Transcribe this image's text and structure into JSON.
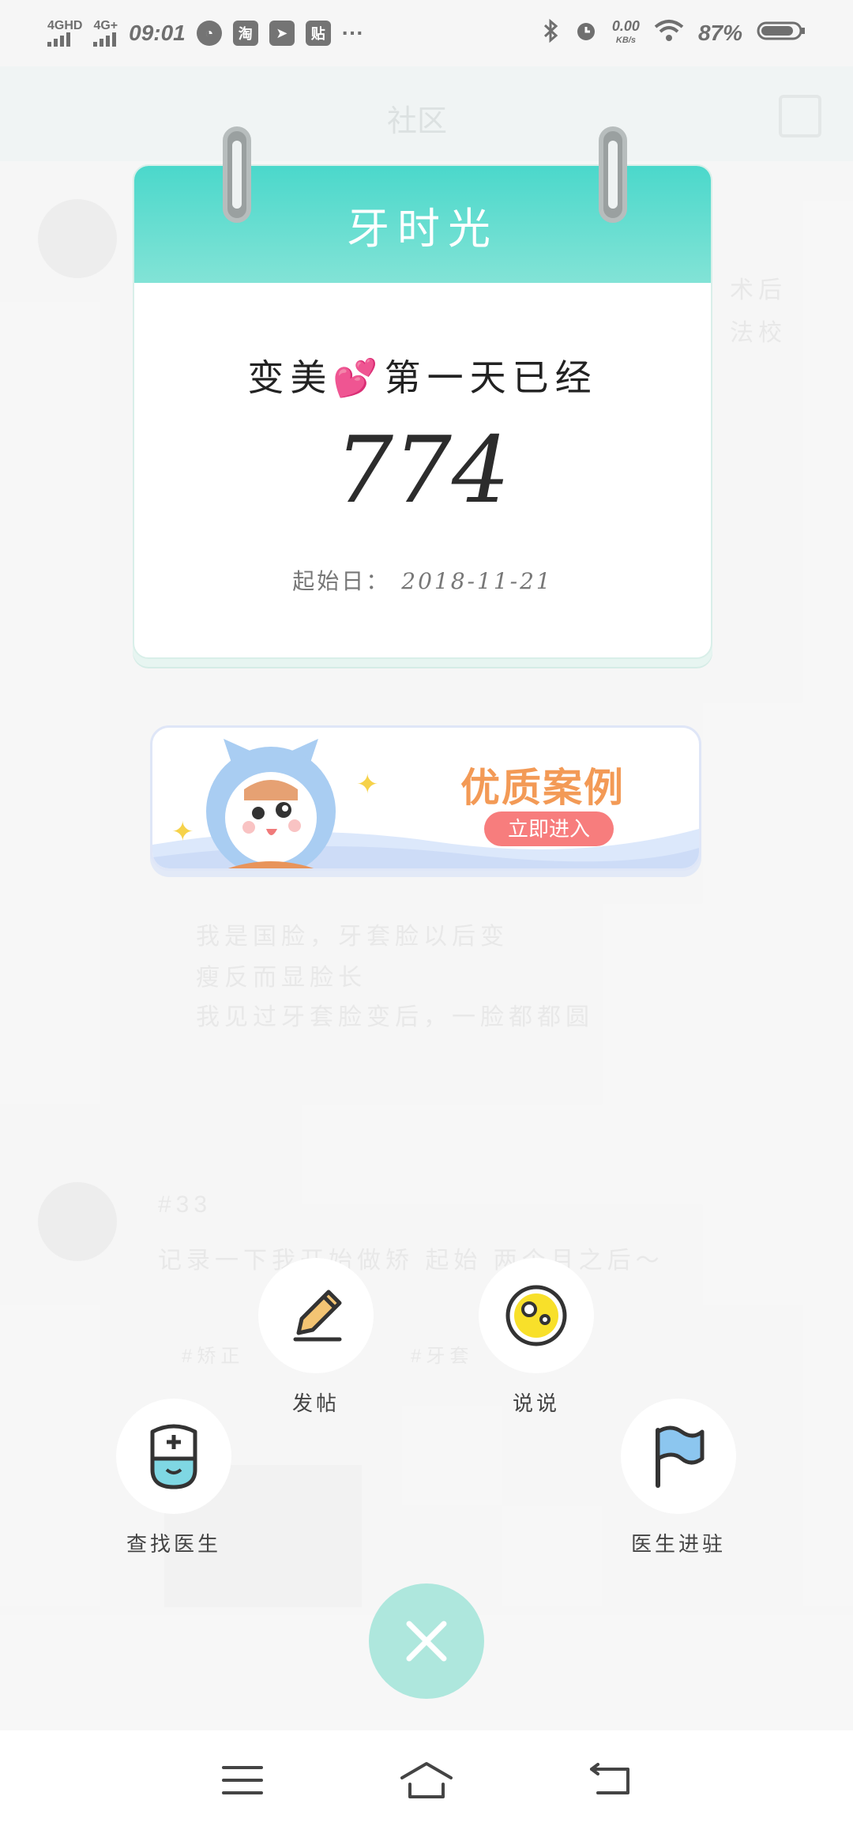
{
  "status_bar": {
    "network_1": "4GHD",
    "network_2": "4G+",
    "time": "09:01",
    "app_icons": [
      "speedometer-icon",
      "taobao-icon",
      "telegram-icon",
      "tieba-icon"
    ],
    "more": "···",
    "net_speed": "0.00",
    "net_speed_unit": "KB/s",
    "battery": "87%"
  },
  "calendar": {
    "title": "牙时光",
    "subtitle_before": "变美",
    "subtitle_heart": "💕",
    "subtitle_after": "第一天已经",
    "day_count": "774",
    "start_label": "起始日：",
    "start_date": "2018-11-21"
  },
  "banner": {
    "title": "优质案例",
    "button": "立即进入"
  },
  "actions": {
    "post": "发帖",
    "talk": "说说",
    "find_doctor": "查找医生",
    "doctor_join": "医生进驻"
  },
  "background": {
    "header_title": "社区",
    "lines": [
      "术后",
      "法校",
      "我是国脸，牙套脸以后变",
      "瘦反而显脸长",
      "我见过牙套脸变后，一脸都都圆",
      "#33",
      "记录一下我开始做矫 起始 两个月之后～",
      "#矫正",
      "#牙套"
    ]
  },
  "colors": {
    "teal_accent": "#4bd8cb",
    "banner_orange": "#f39a56",
    "banner_button": "#f77d7d",
    "close_fab": "#aee7dd"
  }
}
